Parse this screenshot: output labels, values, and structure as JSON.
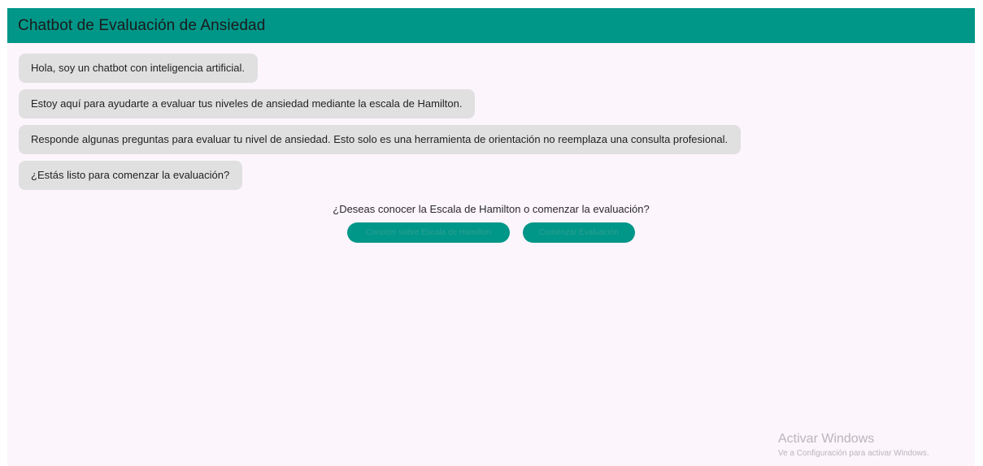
{
  "app": {
    "title": "Chatbot de Evaluación de Ansiedad",
    "accent_color": "#009688",
    "background_color": "#fcf5fc"
  },
  "messages": [
    {
      "text": "Hola, soy un chatbot con inteligencia artificial."
    },
    {
      "text": "Estoy aquí para ayudarte a evaluar tus niveles de ansiedad mediante la escala de Hamilton."
    },
    {
      "text": "Responde algunas preguntas para evaluar tu nivel de ansiedad. Esto solo es una herramienta de orientación no reemplaza una consulta profesional."
    },
    {
      "text": "¿Estás listo para comenzar la evaluación?"
    }
  ],
  "prompt": {
    "question": "¿Deseas conocer la Escala de Hamilton o comenzar la evaluación?",
    "buttons": {
      "hamilton_label": "Conocer sobre Escala de Hamilton",
      "start_label": "Comenzar Evaluación"
    }
  },
  "watermark": {
    "title": "Activar Windows",
    "subtitle": "Ve a Configuración para activar Windows."
  }
}
